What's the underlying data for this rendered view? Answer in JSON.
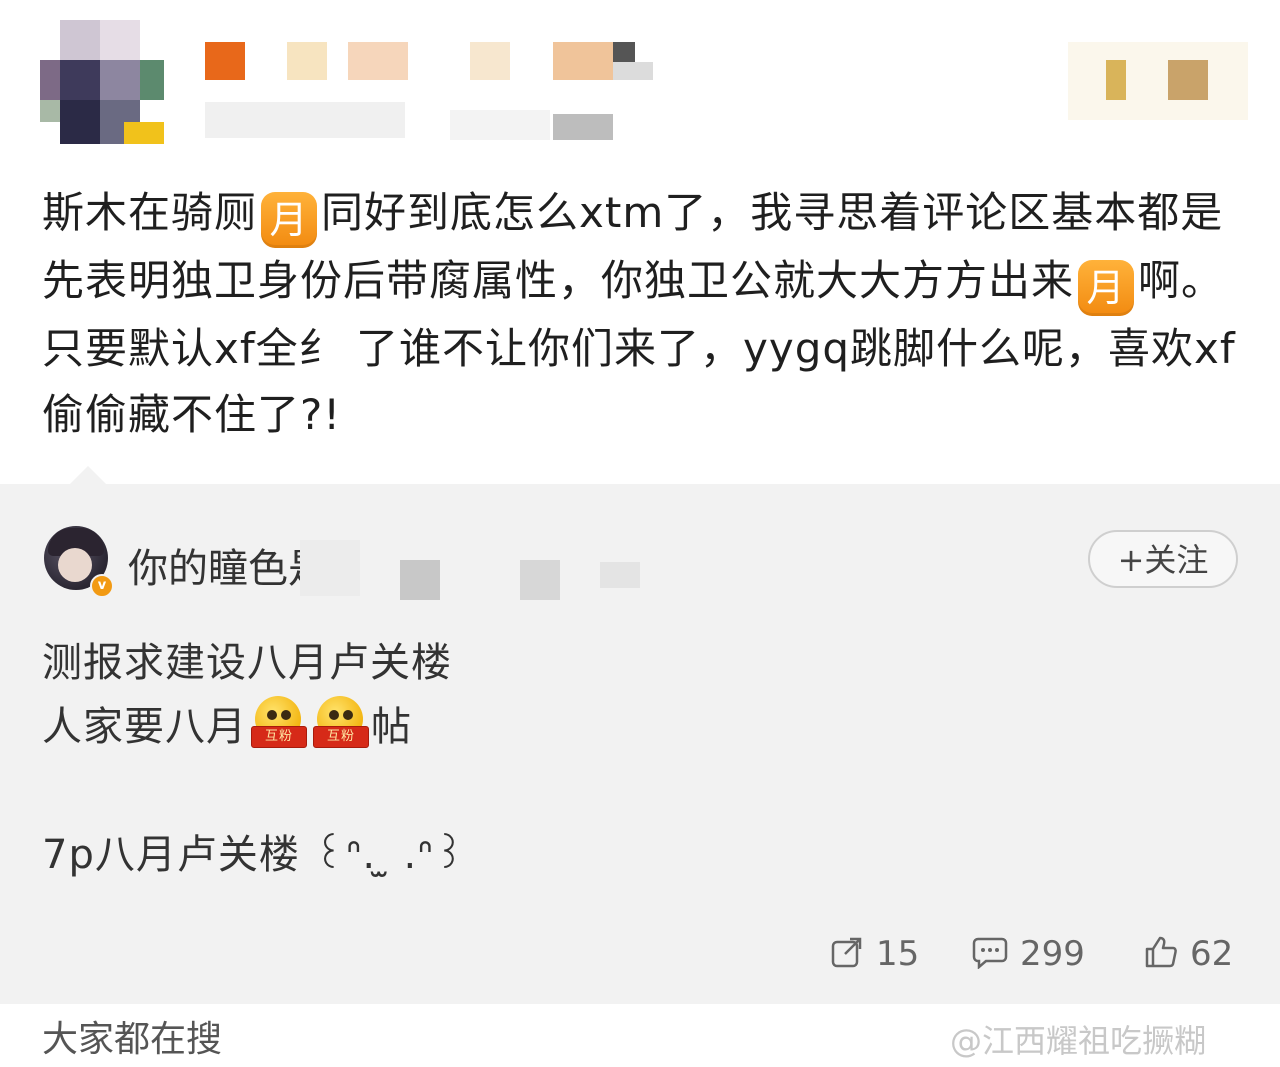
{
  "post": {
    "text_parts": [
      "斯木在骑厕",
      "同好到底怎么xtm了，我寻思着评论区基本都是先表明独卫身份后带腐属性，你独卫公就大大方方出来",
      "啊。只要默认xf全纟 了谁不让你们来了，yygq跳脚什么呢，喜欢xf偷偷藏不住了?!"
    ],
    "moon_emoji": "月"
  },
  "quoted": {
    "username": "你的瞳色是",
    "verified_badge": "v",
    "follow_label": "+关注",
    "line1": "测报求建设八月卢关楼",
    "line2_prefix": "人家要八月",
    "line2_suffix": "帖",
    "hufen_tag": "互粉",
    "line3": "7p八月卢关楼 ꒰ᐢ. ̫ .ᐢ꒱",
    "actions": {
      "repost_count": "15",
      "comment_count": "299",
      "like_count": "62"
    }
  },
  "footer": {
    "label": "大家都在搜",
    "watermark": "@江西耀祖吃撅糊"
  }
}
